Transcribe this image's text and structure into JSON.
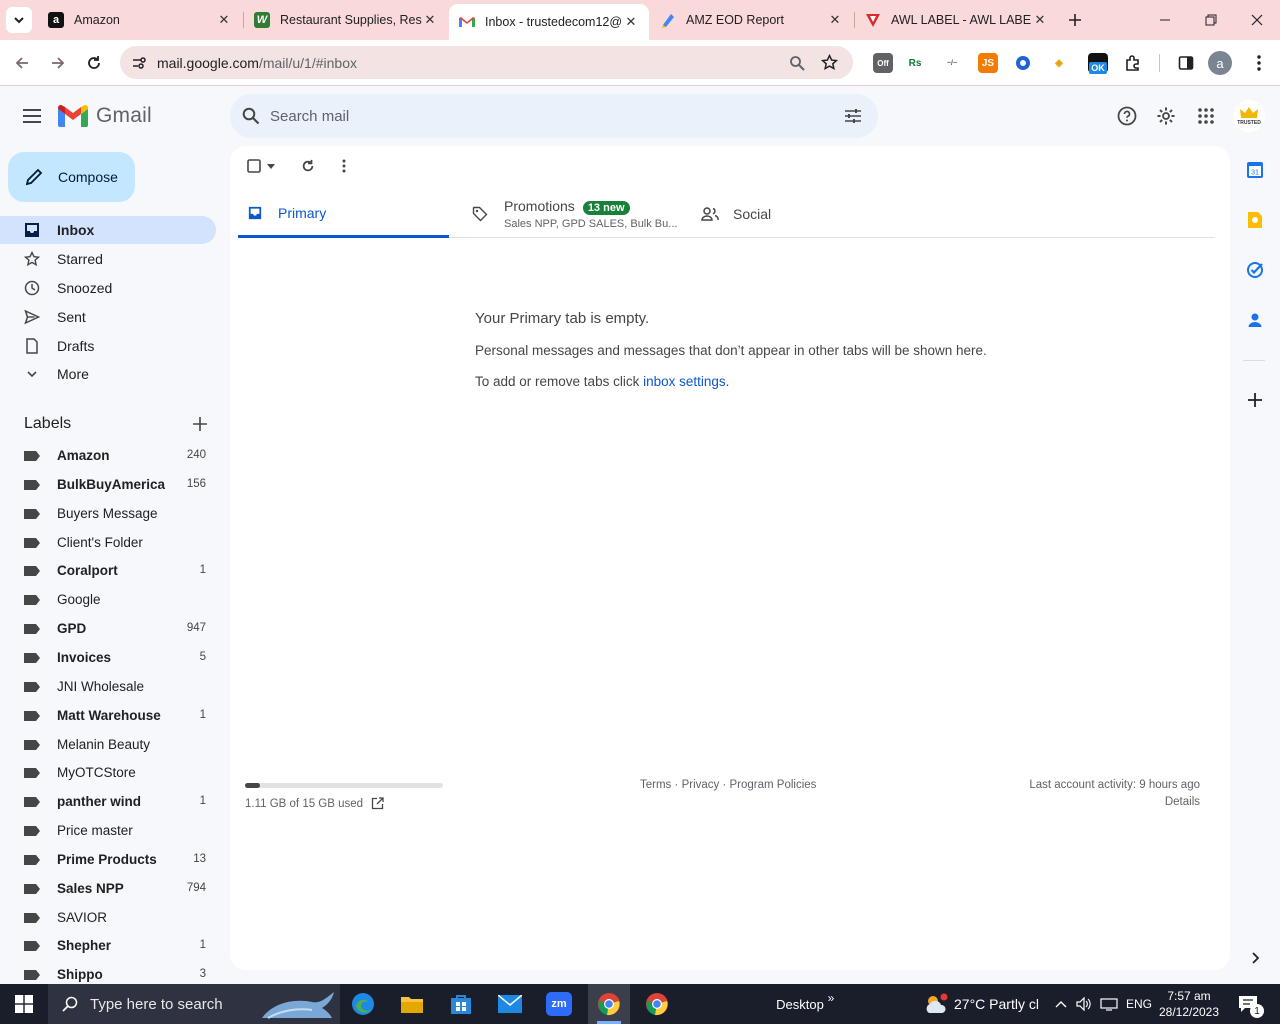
{
  "browser": {
    "tabs": [
      {
        "title": "Amazon",
        "favicon": "amazon-favicon",
        "active": false
      },
      {
        "title": "Restaurant Supplies, Resta",
        "favicon": "webstaurant-favicon",
        "active": false
      },
      {
        "title": "Inbox - trustedecom12@",
        "favicon": "gmail-favicon",
        "active": true
      },
      {
        "title": "AMZ EOD Report",
        "favicon": "docs-favicon",
        "active": false
      },
      {
        "title": "AWL LABEL - AWL LABEL",
        "favicon": "awl-favicon",
        "active": false
      }
    ],
    "url_host": "mail.google.com",
    "url_path": "/mail/u/1/#inbox",
    "profile_initial": "a",
    "accent": "#f9d9d9"
  },
  "gmail": {
    "logo_text": "Gmail",
    "search_placeholder": "Search mail",
    "compose_label": "Compose",
    "nav": [
      {
        "label": "Inbox",
        "icon": "inbox-icon",
        "active": true
      },
      {
        "label": "Starred",
        "icon": "star-icon",
        "active": false
      },
      {
        "label": "Snoozed",
        "icon": "clock-icon",
        "active": false
      },
      {
        "label": "Sent",
        "icon": "send-icon",
        "active": false
      },
      {
        "label": "Drafts",
        "icon": "draft-icon",
        "active": false
      },
      {
        "label": "More",
        "icon": "chevron-down-icon",
        "active": false
      }
    ],
    "labels_heading": "Labels",
    "labels": [
      {
        "name": "Amazon",
        "count": "240",
        "bold": true
      },
      {
        "name": "BulkBuyAmerica",
        "count": "156",
        "bold": true
      },
      {
        "name": "Buyers Message",
        "count": "",
        "bold": false
      },
      {
        "name": "Client's Folder",
        "count": "",
        "bold": false
      },
      {
        "name": "Coralport",
        "count": "1",
        "bold": true
      },
      {
        "name": "Google",
        "count": "",
        "bold": false
      },
      {
        "name": "GPD",
        "count": "947",
        "bold": true
      },
      {
        "name": "Invoices",
        "count": "5",
        "bold": true
      },
      {
        "name": "JNI Wholesale",
        "count": "",
        "bold": false
      },
      {
        "name": "Matt Warehouse",
        "count": "1",
        "bold": true
      },
      {
        "name": "Melanin Beauty",
        "count": "",
        "bold": false
      },
      {
        "name": "MyOTCStore",
        "count": "",
        "bold": false
      },
      {
        "name": "panther wind",
        "count": "1",
        "bold": true
      },
      {
        "name": "Price master",
        "count": "",
        "bold": false
      },
      {
        "name": "Prime Products",
        "count": "13",
        "bold": true
      },
      {
        "name": "Sales NPP",
        "count": "794",
        "bold": true
      },
      {
        "name": "SAVIOR",
        "count": "",
        "bold": false
      },
      {
        "name": "Shepher",
        "count": "1",
        "bold": true
      },
      {
        "name": "Shippo",
        "count": "3",
        "bold": true
      }
    ],
    "inbox_tabs": [
      {
        "label": "Primary",
        "icon": "inbox-tab-icon",
        "selected": true,
        "badge": "",
        "subtitle": ""
      },
      {
        "label": "Promotions",
        "icon": "tag-icon",
        "selected": false,
        "badge": "13 new",
        "subtitle": "Sales NPP, GPD SALES, Bulk Bu..."
      },
      {
        "label": "Social",
        "icon": "people-icon",
        "selected": false,
        "badge": "",
        "subtitle": ""
      }
    ],
    "empty": {
      "heading": "Your Primary tab is empty.",
      "message": "Personal messages and messages that don’t appear in other tabs will be shown here.",
      "prefix": "To add or remove tabs click ",
      "link": "inbox settings",
      "suffix": "."
    },
    "footer": {
      "storage": "1.11 GB of 15 GB used",
      "storage_fraction": 0.074,
      "terms": "Terms",
      "privacy": "Privacy",
      "policies": "Program Policies",
      "dot": "·",
      "activity": "Last account activity: 9 hours ago",
      "details": "Details"
    },
    "account_badge": "TRUSTED",
    "accent": "#0b57d0",
    "compose_color": "#c2e7ff"
  },
  "taskbar": {
    "search_placeholder": "Type here to search",
    "desktop": "Desktop",
    "weather": "27°C  Partly cl",
    "language": "ENG",
    "time": "7:57 am",
    "date": "28/12/2023",
    "notif_count": "1"
  }
}
